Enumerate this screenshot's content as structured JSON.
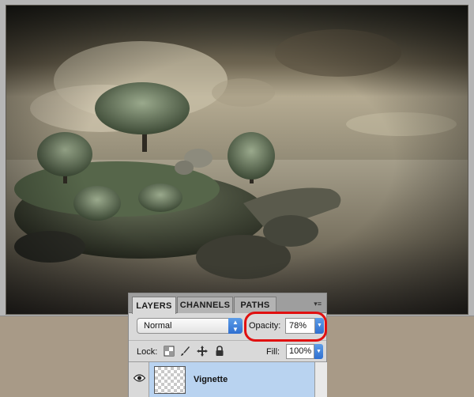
{
  "layers_panel": {
    "tabs": [
      {
        "label": "LAYERS",
        "active": true
      },
      {
        "label": "CHANNELS",
        "active": false
      },
      {
        "label": "PATHS",
        "active": false
      }
    ],
    "blend_mode": "Normal",
    "opacity_label": "Opacity:",
    "opacity_value": "78%",
    "lock_label": "Lock:",
    "fill_label": "Fill:",
    "fill_value": "100%",
    "layers": [
      {
        "name": "Vignette",
        "visible": true,
        "selected": true
      }
    ]
  },
  "colors": {
    "highlight": "#e01010",
    "selected_layer": "#b9d3f0",
    "accent_blue": "#2f6fd0"
  },
  "icons": {
    "lock_transparent": "checker-square-icon",
    "lock_image": "brush-icon",
    "lock_position": "move-arrows-icon",
    "lock_all": "padlock-icon",
    "visibility": "eye-icon",
    "panel_menu": "panel-menu-icon"
  }
}
